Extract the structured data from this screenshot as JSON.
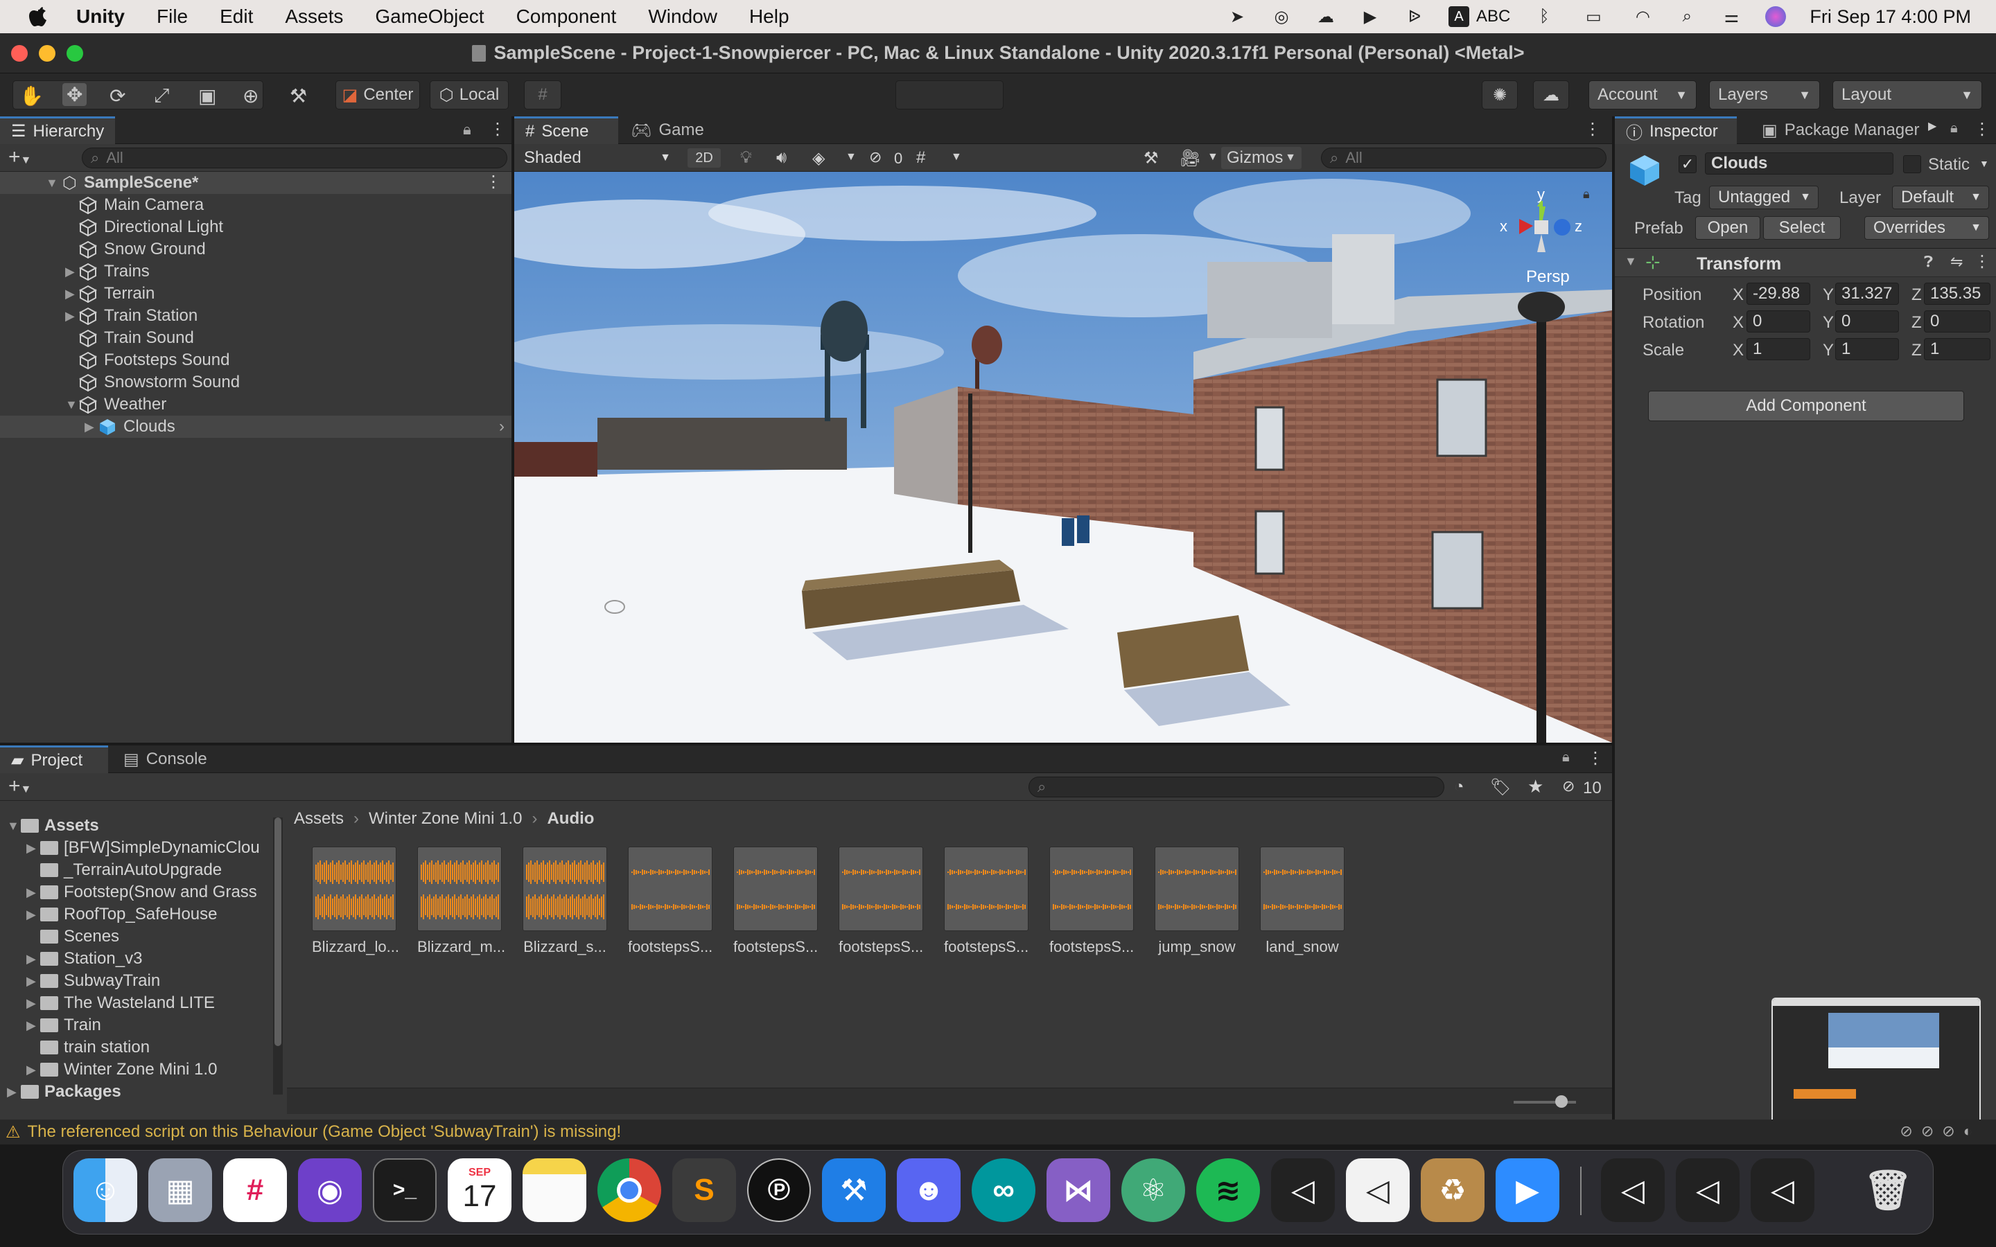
{
  "menubar": {
    "app_name": "Unity",
    "items": [
      "File",
      "Edit",
      "Assets",
      "GameObject",
      "Component",
      "Window",
      "Help"
    ],
    "input_source": "ABC",
    "clock": "Fri Sep 17  4:00 PM"
  },
  "window": {
    "title": "SampleScene - Project-1-Snowpiercer - PC, Mac & Linux Standalone - Unity 2020.3.17f1 Personal (Personal) <Metal>"
  },
  "toolbar": {
    "pivot_label": "Center",
    "space_label": "Local",
    "account_label": "Account",
    "layers_label": "Layers",
    "layout_label": "Layout"
  },
  "hierarchy": {
    "tab_label": "Hierarchy",
    "search_placeholder": "All",
    "scene_name": "SampleScene*",
    "items": [
      {
        "label": "Main Camera",
        "expandable": false
      },
      {
        "label": "Directional Light",
        "expandable": false
      },
      {
        "label": "Snow Ground",
        "expandable": false
      },
      {
        "label": "Trains",
        "expandable": true
      },
      {
        "label": "Terrain",
        "expandable": true
      },
      {
        "label": "Train Station",
        "expandable": true
      },
      {
        "label": "Train Sound",
        "expandable": false
      },
      {
        "label": "Footsteps Sound",
        "expandable": false
      },
      {
        "label": "Snowstorm Sound",
        "expandable": false
      },
      {
        "label": "Weather",
        "expandable": true
      },
      {
        "label": "Clouds",
        "expandable": true
      }
    ]
  },
  "scene_view": {
    "tabs": [
      "Scene",
      "Game"
    ],
    "shading_mode": "Shaded",
    "mode_2d": "2D",
    "hidden_count": "0",
    "gizmos_label": "Gizmos",
    "search_placeholder": "All",
    "persp_label": "Persp",
    "axis_x": "x",
    "axis_y": "y",
    "axis_z": "z"
  },
  "inspector": {
    "tabs": [
      "Inspector",
      "Package Manager"
    ],
    "object_name": "Clouds",
    "static_label": "Static",
    "tag_label": "Tag",
    "tag_value": "Untagged",
    "layer_label": "Layer",
    "layer_value": "Default",
    "prefab_label": "Prefab",
    "prefab_open": "Open",
    "prefab_select": "Select",
    "prefab_overrides": "Overrides",
    "transform_title": "Transform",
    "position_label": "Position",
    "rotation_label": "Rotation",
    "scale_label": "Scale",
    "axis_x": "X",
    "axis_y": "Y",
    "axis_z": "Z",
    "position": {
      "x": "-29.88",
      "y": "31.327",
      "z": "135.35"
    },
    "rotation": {
      "x": "0",
      "y": "0",
      "z": "0"
    },
    "scale": {
      "x": "1",
      "y": "1",
      "z": "1"
    },
    "add_component": "Add Component"
  },
  "project": {
    "tabs": [
      "Project",
      "Console"
    ],
    "hidden_count": "10",
    "breadcrumb": [
      "Assets",
      "Winter Zone Mini 1.0",
      "Audio"
    ],
    "tree": [
      {
        "label": "Assets",
        "level": 0,
        "expandable": true,
        "open": true
      },
      {
        "label": "[BFW]SimpleDynamicClou",
        "level": 1,
        "expandable": true
      },
      {
        "label": "_TerrainAutoUpgrade",
        "level": 1,
        "expandable": false
      },
      {
        "label": "Footstep(Snow and Grass",
        "level": 1,
        "expandable": true
      },
      {
        "label": "RoofTop_SafeHouse",
        "level": 1,
        "expandable": true
      },
      {
        "label": "Scenes",
        "level": 1,
        "expandable": false
      },
      {
        "label": "Station_v3",
        "level": 1,
        "expandable": true
      },
      {
        "label": "SubwayTrain",
        "level": 1,
        "expandable": true
      },
      {
        "label": "The Wasteland LITE",
        "level": 1,
        "expandable": true
      },
      {
        "label": "Train",
        "level": 1,
        "expandable": true
      },
      {
        "label": "train station",
        "level": 1,
        "expandable": false
      },
      {
        "label": "Winter Zone Mini 1.0",
        "level": 1,
        "expandable": true
      },
      {
        "label": "Packages",
        "level": 0,
        "expandable": true,
        "open": false
      }
    ],
    "assets": [
      {
        "label": "Blizzard_lo...",
        "loud": true
      },
      {
        "label": "Blizzard_m...",
        "loud": true
      },
      {
        "label": "Blizzard_s...",
        "loud": true
      },
      {
        "label": "footstepsS...",
        "loud": false
      },
      {
        "label": "footstepsS...",
        "loud": false
      },
      {
        "label": "footstepsS...",
        "loud": false
      },
      {
        "label": "footstepsS...",
        "loud": false
      },
      {
        "label": "footstepsS...",
        "loud": false
      },
      {
        "label": "jump_snow",
        "loud": false
      },
      {
        "label": "land_snow",
        "loud": false
      }
    ]
  },
  "status": {
    "warning": "The referenced script on this Behaviour (Game Object 'SubwayTrain') is missing!"
  },
  "dock": {
    "calendar_month": "SEP",
    "calendar_day": "17"
  },
  "colors": {
    "accent_blue": "#3a79bb",
    "waveform_orange": "#f08a1a",
    "selection": "#4d4d4d",
    "warning_yellow": "#e8b13b"
  }
}
